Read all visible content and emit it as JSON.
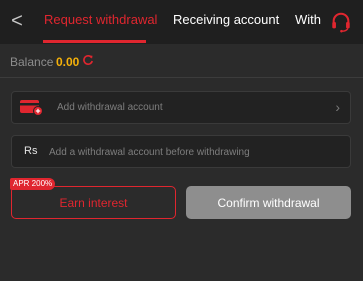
{
  "header": {
    "back_label": "<",
    "tabs": [
      {
        "label": "Request withdrawal",
        "active": true
      },
      {
        "label": "Receiving account",
        "active": false
      },
      {
        "label": "With",
        "active": false
      }
    ],
    "support_icon": "headset-icon"
  },
  "balance": {
    "label": "Balance",
    "value": "0.00",
    "refresh_icon": "refresh-icon"
  },
  "account_field": {
    "icon": "card-add-icon",
    "text": "Add withdrawal account",
    "chevron": "›"
  },
  "amount_field": {
    "currency": "Rs",
    "placeholder": "Add a withdrawal account before withdrawing"
  },
  "actions": {
    "apr_badge": "APR 200%",
    "earn_label": "Earn interest",
    "confirm_label": "Confirm withdrawal"
  },
  "colors": {
    "accent": "#e0262f",
    "balance": "#f5b10a",
    "background": "#2b2b2b",
    "disabled_button": "#8e8e8e"
  }
}
